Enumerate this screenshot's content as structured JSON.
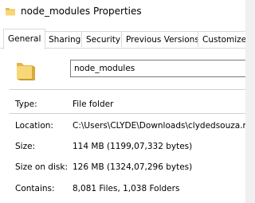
{
  "window": {
    "title": "node_modules Properties"
  },
  "tabs": [
    {
      "label": "General",
      "active": true
    },
    {
      "label": "Sharing",
      "active": false
    },
    {
      "label": "Security",
      "active": false
    },
    {
      "label": "Previous Versions",
      "active": false
    },
    {
      "label": "Customize",
      "active": false
    }
  ],
  "general": {
    "folder_icon": "folder-icon",
    "name": "node_modules",
    "type_label": "Type:",
    "type_value": "File folder",
    "location_label": "Location:",
    "location_value": "C:\\Users\\CLYDE\\Downloads\\clydedsouza.me",
    "size_label": "Size:",
    "size_value": "114 MB (1199,07,332 bytes)",
    "size_on_disk_label": "Size on disk:",
    "size_on_disk_value": "126 MB (1324,07,296 bytes)",
    "contains_label": "Contains:",
    "contains_value": "8,081 Files, 1,038 Folders"
  },
  "colors": {
    "folder_yellow": "#f8d776",
    "folder_dark": "#e3b64a"
  }
}
